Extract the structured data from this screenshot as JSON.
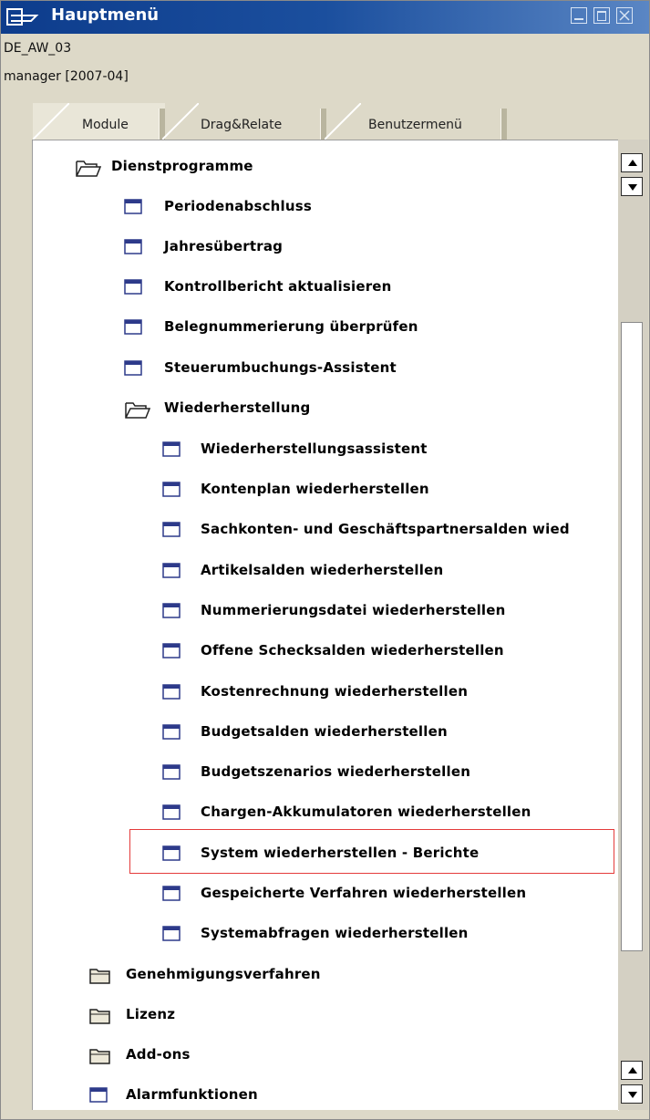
{
  "window": {
    "title": "Hauptmenü",
    "company": "DE_AW_03",
    "user": "manager  [2007-04]"
  },
  "tabs": [
    {
      "label": "Module",
      "active": true
    },
    {
      "label": "Drag&Relate",
      "active": false
    },
    {
      "label": "Benutzermenü",
      "active": false
    }
  ],
  "tree": [
    {
      "label": "Dienstprogramme",
      "icon": "folder-open-icon",
      "level": 0
    },
    {
      "label": "Periodenabschluss",
      "icon": "window-icon",
      "level": 1
    },
    {
      "label": "Jahresübertrag",
      "icon": "window-icon",
      "level": 1
    },
    {
      "label": "Kontrollbericht aktualisieren",
      "icon": "window-icon",
      "level": 1
    },
    {
      "label": "Belegnummerierung überprüfen",
      "icon": "window-icon",
      "level": 1
    },
    {
      "label": "Steuerumbuchungs-Assistent",
      "icon": "window-icon",
      "level": 1
    },
    {
      "label": "Wiederherstellung",
      "icon": "folder-open-icon",
      "level": 1
    },
    {
      "label": "Wiederherstellungsassistent",
      "icon": "window-icon",
      "level": 2
    },
    {
      "label": "Kontenplan wiederherstellen",
      "icon": "window-icon",
      "level": 2
    },
    {
      "label": "Sachkonten- und Geschäftspartnersalden wied",
      "icon": "window-icon",
      "level": 2
    },
    {
      "label": "Artikelsalden wiederherstellen",
      "icon": "window-icon",
      "level": 2
    },
    {
      "label": "Nummerierungsdatei wiederherstellen",
      "icon": "window-icon",
      "level": 2
    },
    {
      "label": "Offene Schecksalden wiederherstellen",
      "icon": "window-icon",
      "level": 2
    },
    {
      "label": "Kostenrechnung wiederherstellen",
      "icon": "window-icon",
      "level": 2
    },
    {
      "label": "Budgetsalden wiederherstellen",
      "icon": "window-icon",
      "level": 2
    },
    {
      "label": "Budgetszenarios wiederherstellen",
      "icon": "window-icon",
      "level": 2
    },
    {
      "label": "Chargen-Akkumulatoren wiederherstellen",
      "icon": "window-icon",
      "level": 2
    },
    {
      "label": "System wiederherstellen - Berichte",
      "icon": "window-icon",
      "level": 2,
      "highlighted": true
    },
    {
      "label": "Gespeicherte Verfahren wiederherstellen",
      "icon": "window-icon",
      "level": 2
    },
    {
      "label": "Systemabfragen wiederherstellen",
      "icon": "window-icon",
      "level": 2
    },
    {
      "label": "Genehmigungsverfahren",
      "icon": "folder-closed-icon",
      "level": 0
    },
    {
      "label": "Lizenz",
      "icon": "folder-closed-icon",
      "level": 0
    },
    {
      "label": "Add-ons",
      "icon": "folder-closed-icon",
      "level": 0
    },
    {
      "label": "Alarmfunktionen",
      "icon": "window-icon",
      "level": 0
    }
  ]
}
